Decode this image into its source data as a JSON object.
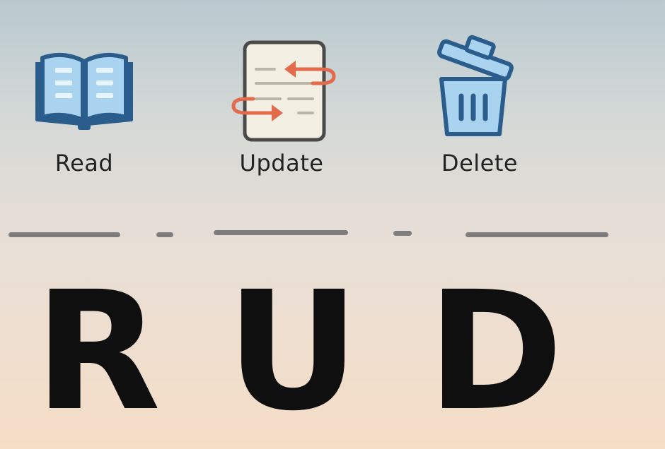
{
  "items": [
    {
      "label": "Read",
      "icon": "open-book-icon"
    },
    {
      "label": "Update",
      "icon": "document-update-icon"
    },
    {
      "label": "Delete",
      "icon": "trash-can-icon"
    }
  ],
  "letters": [
    "R",
    "U",
    "D"
  ],
  "colors": {
    "icon_outline": "#2a5d8c",
    "icon_fill": "#a9d3ef",
    "update_arrow": "#e46a4c",
    "paper": "#f3efe2",
    "letter": "#0f0f0f",
    "dash": "#7d7d7d"
  }
}
